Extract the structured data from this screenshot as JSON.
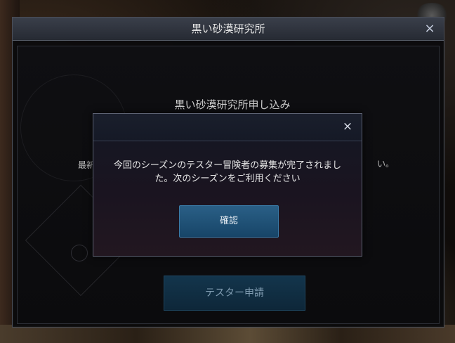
{
  "main_window": {
    "title": "黒い砂漠研究所",
    "close_glyph": "×",
    "subtitle": "黒い砂漠研究所申し込み",
    "ellipsis": "··",
    "intro_start": "最新",
    "intro_end": "い。",
    "apply_button_label": "テスター申請"
  },
  "dialog": {
    "close_glyph": "×",
    "message": "今回のシーズンのテスター冒険者の募集が完了されました。次のシーズンをご利用ください",
    "confirm_label": "確認"
  }
}
